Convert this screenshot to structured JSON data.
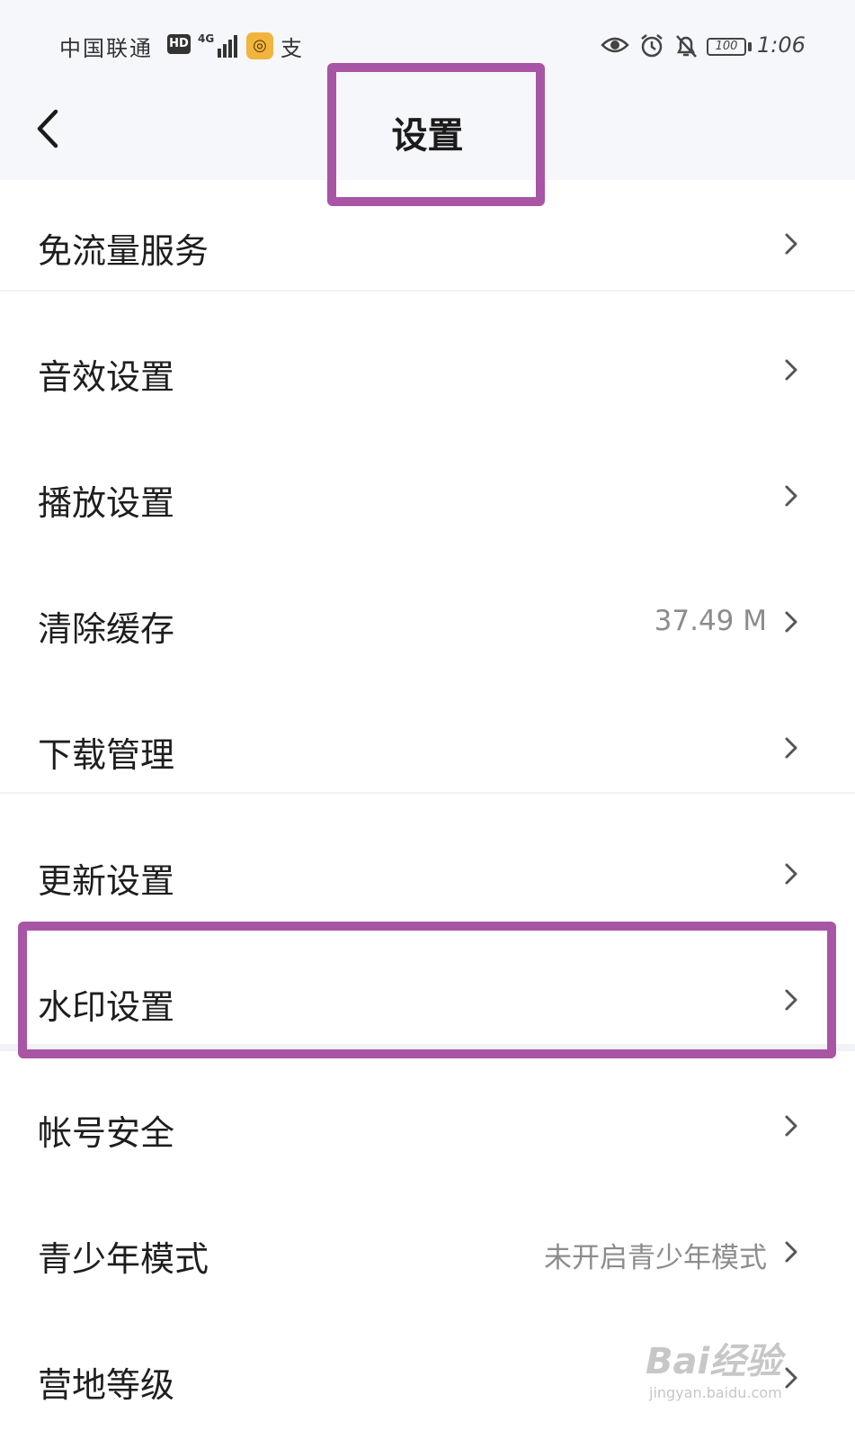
{
  "status_bar": {
    "carrier": "中国联通",
    "hd": "HD",
    "network": "4G",
    "app_icon_glyph": "◎",
    "extra_glyph": "支",
    "battery": "100",
    "time": "1:06"
  },
  "header": {
    "title": "设置"
  },
  "settings": [
    {
      "label": "免流量服务",
      "value": ""
    },
    {
      "label": "音效设置",
      "value": ""
    },
    {
      "label": "播放设置",
      "value": ""
    },
    {
      "label": "清除缓存",
      "value": "37.49 M"
    },
    {
      "label": "下载管理",
      "value": ""
    },
    {
      "label": "更新设置",
      "value": ""
    },
    {
      "label": "水印设置",
      "value": ""
    },
    {
      "label": "帐号安全",
      "value": ""
    },
    {
      "label": "青少年模式",
      "value": "未开启青少年模式"
    },
    {
      "label": "营地等级",
      "value": ""
    }
  ],
  "watermark": {
    "brand": "Bai经验",
    "url": "jingyan.baidu.com"
  },
  "colors": {
    "highlight": "#a855a5",
    "header_bg": "#f6f7fb"
  },
  "icons": [
    "back-arrow-icon",
    "chevron-right-icon",
    "eye-icon",
    "alarm-icon",
    "bell-off-icon",
    "battery-icon",
    "signal-icon"
  ]
}
